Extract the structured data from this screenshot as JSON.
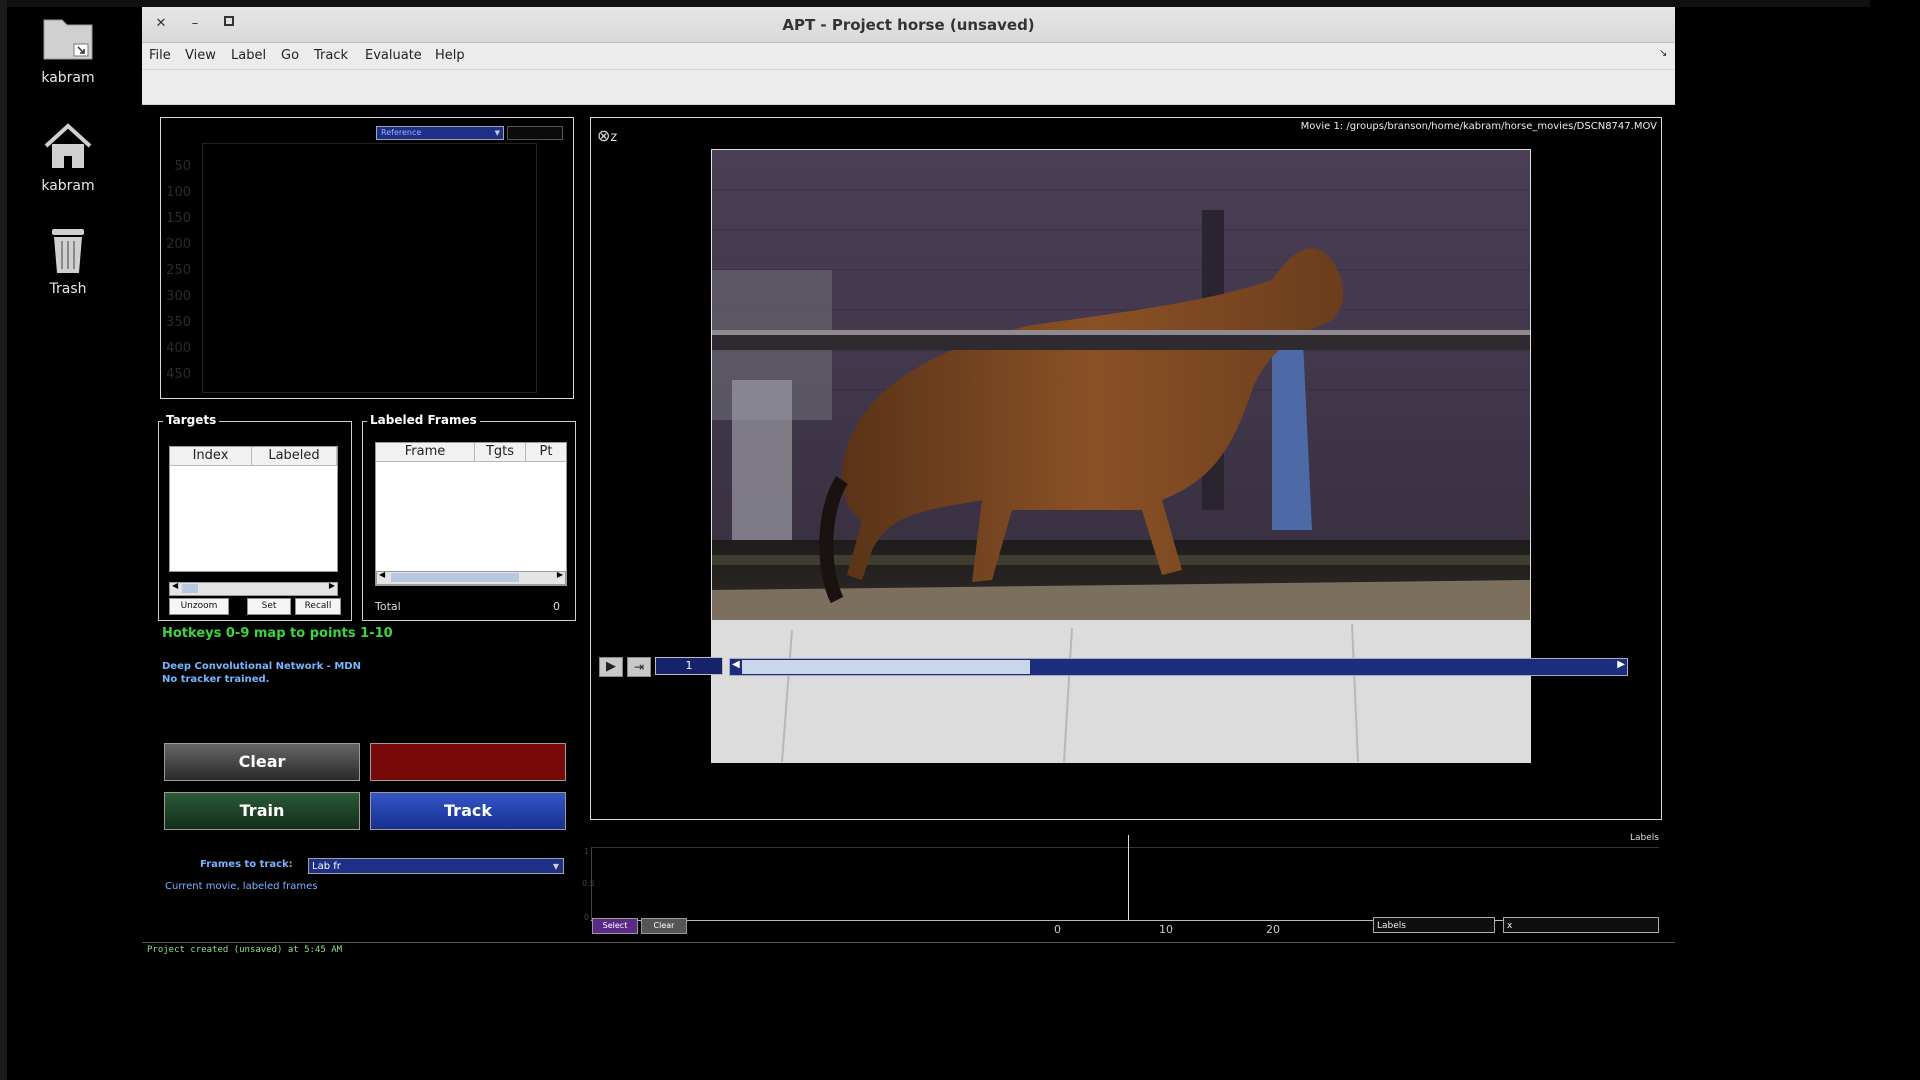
{
  "desktop": {
    "icons": [
      {
        "label": "kabram",
        "icon": "folder-icon"
      },
      {
        "label": "kabram",
        "icon": "home-icon"
      },
      {
        "label": "Trash",
        "icon": "trash-icon"
      }
    ]
  },
  "window": {
    "title": "APT - Project horse (unsaved)",
    "close": "✕",
    "minimize": "–",
    "maximize": "▫",
    "menu": [
      "File",
      "View",
      "Label",
      "Go",
      "Track",
      "Evaluate",
      "Help"
    ],
    "menu_overflow": "↘"
  },
  "reference_panel": {
    "dropdown_value": "Reference",
    "y_ticks": [
      "50",
      "100",
      "150",
      "200",
      "250",
      "300",
      "350",
      "400",
      "450"
    ]
  },
  "targets": {
    "legend": "Targets",
    "columns": [
      "Index",
      "Labeled"
    ],
    "buttons": {
      "unzoom": "Unzoom",
      "set": "Set",
      "recall": "Recall"
    }
  },
  "labeled_frames": {
    "legend": "Labeled Frames",
    "columns": [
      "Frame",
      "Tgts",
      "Pt"
    ],
    "total_label": "Total",
    "total_value": "0"
  },
  "info": {
    "hotkeys": "Hotkeys 0-9 map to points 1-10",
    "tracker_line1": "Deep Convolutional Network - MDN",
    "tracker_line2": "No tracker trained."
  },
  "actions": {
    "clear": "Clear",
    "red_button": "",
    "train": "Train",
    "track": "Track",
    "frames_to_track_label": "Frames to track:",
    "frames_to_track_value": "Lab fr",
    "frames_note": "Current movie, labeled frames"
  },
  "viewer": {
    "movie_path": "Movie 1: /groups/branson/home/kabram/horse_movies/DSCN8747.MOV",
    "frame_number": "1",
    "zoom_icon_text": "z",
    "slider_position": 0.33
  },
  "timeline": {
    "right_label": "Labels",
    "y_ticks": [
      "1",
      "0.5",
      "0"
    ],
    "x_ticks": [
      "0",
      "10",
      "20"
    ],
    "select_button": "Select",
    "clear_button": "Clear",
    "labels_dropdown": "Labels",
    "second_dropdown": "x"
  },
  "status": {
    "text": "Project created (unsaved) at 5:45 AM"
  },
  "colors": {
    "hotkey_green": "#3cd63c",
    "info_blue": "#79b4ff",
    "track_blue": "#1f3fa8",
    "train_green": "#173d22",
    "red_button": "#7a0a0a",
    "status_green": "#8de08d"
  }
}
